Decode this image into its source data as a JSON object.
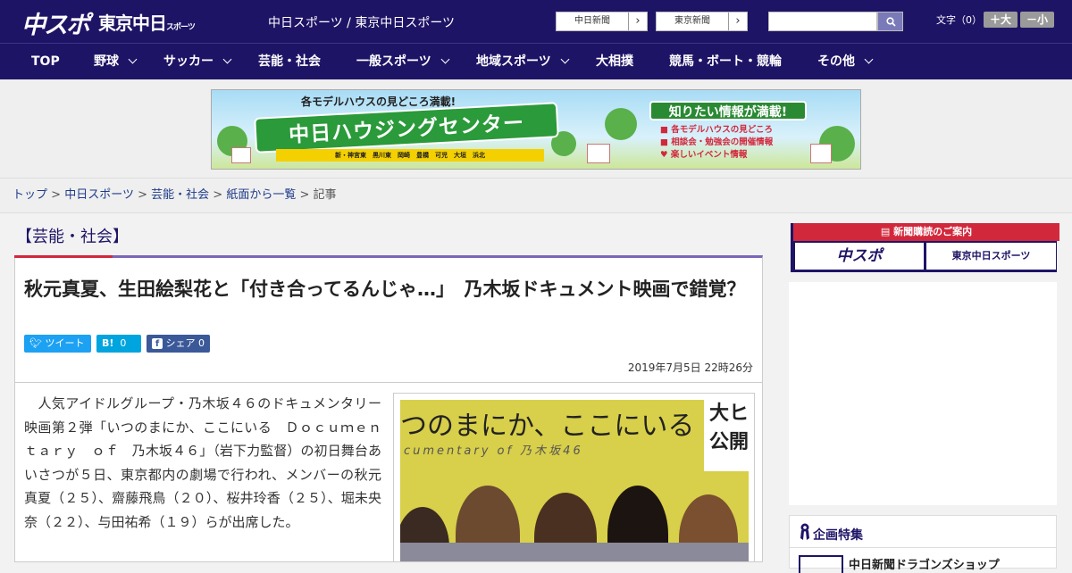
{
  "header": {
    "logo_chu": "中スポ",
    "logo_tokyo": "東京中日",
    "logo_tokyo_small": "スポーツ",
    "site_title": "中日スポーツ / 東京中日スポーツ",
    "paper_buttons": [
      {
        "label": "中日新聞"
      },
      {
        "label": "東京新聞"
      }
    ],
    "search_placeholder": "",
    "font_size_label": "文字（0）",
    "font_larger": "＋大",
    "font_smaller": "－小"
  },
  "nav": [
    {
      "label": "TOP",
      "dropdown": false
    },
    {
      "label": "野球",
      "dropdown": true
    },
    {
      "label": "サッカー",
      "dropdown": true
    },
    {
      "label": "芸能・社会",
      "dropdown": false
    },
    {
      "label": "一般スポーツ",
      "dropdown": true
    },
    {
      "label": "地域スポーツ",
      "dropdown": true
    },
    {
      "label": "大相撲",
      "dropdown": false
    },
    {
      "label": "競馬・ボート・競輪",
      "dropdown": false
    },
    {
      "label": "その他",
      "dropdown": true
    }
  ],
  "ad_banner": {
    "top_text": "各モデルハウスの見どころ満載!",
    "main_text": "中日ハウジングセンター",
    "locations": "新・神宮東　黒川東　岡崎　豊橋　可児　大垣　浜北",
    "right_title": "知りたい情報が満載!",
    "right_items": [
      "各モデルハウスの見どころ",
      "相談会・勉強会の開催情報",
      "楽しいイベント情報"
    ]
  },
  "breadcrumb": {
    "items": [
      "トップ",
      "中日スポーツ",
      "芸能・社会",
      "紙面から一覧"
    ],
    "current": "記事",
    "separator": ">"
  },
  "section_title": "【芸能・社会】",
  "article": {
    "headline": "秋元真夏、生田絵梨花と「付き合ってるんじゃ…」　乃木坂ドキュメント映画で錯覚？",
    "share": {
      "tweet": "ツイート",
      "hatena": "B!",
      "hatena_count": "0",
      "facebook": "シェア",
      "facebook_count": "0"
    },
    "date": "2019年7月5日 22時26分",
    "body": "　人気アイドルグループ・乃木坂４６のドキュメンタリー映画第２弾「いつのまにか、ここにいる　Ｄｏｃｕｍｅｎｔａｒｙ　ｏｆ　乃木坂４６」（岩下力監督）の初日舞台あいさつが５日、東京都内の劇場で行われ、メンバーの秋元真夏（２５）、齋藤飛鳥（２０）、桜井玲香（２５）、堀未央奈（２２）、与田祐希（１９）らが出席した。",
    "photo_title": "つのまにか、ここにいる",
    "photo_subtitle": "cumentary of 乃木坂46",
    "photo_right": "大ヒ 公開"
  },
  "sidebar": {
    "subscribe_title": "新聞購読のご案内",
    "subscribe_buttons": [
      "中スポ",
      "東京中日スポーツ"
    ],
    "feature_title": "企画特集",
    "feature_item": "中日新聞ドラゴンズショップ"
  },
  "colors": {
    "brand": "#1e1466",
    "accent_red": "#d2283c",
    "twitter": "#1da1f2",
    "hatena": "#00a4de",
    "facebook": "#3b5998"
  }
}
